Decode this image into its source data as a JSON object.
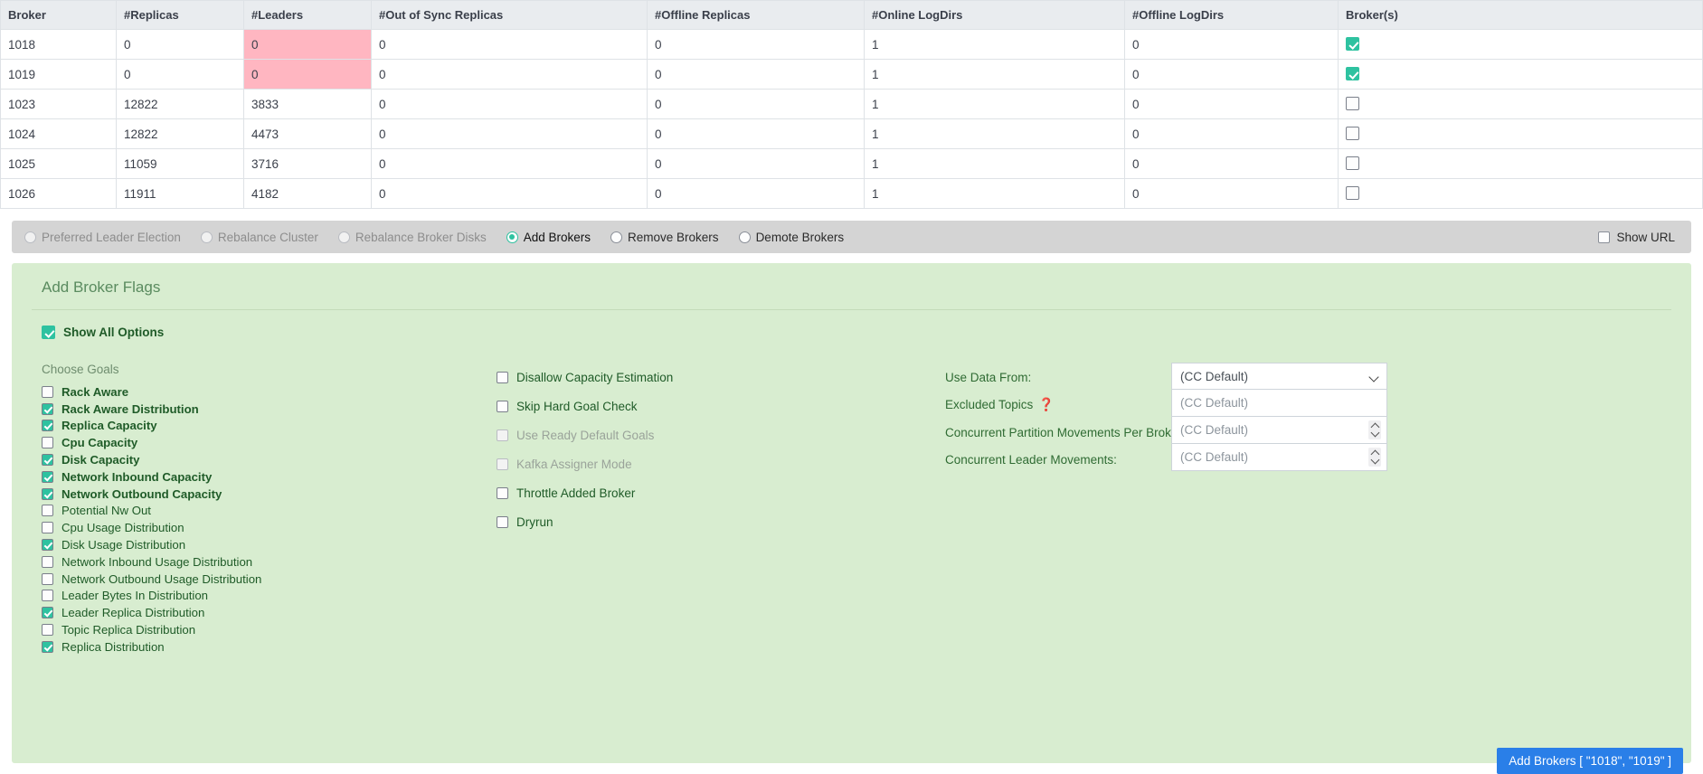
{
  "table": {
    "columns": [
      "Broker",
      "#Replicas",
      "#Leaders",
      "#Out of Sync Replicas",
      "#Offline Replicas",
      "#Online LogDirs",
      "#Offline LogDirs",
      "Broker(s)"
    ],
    "rows": [
      {
        "broker": "1018",
        "replicas": "0",
        "leaders": "0",
        "out_of_sync": "0",
        "offline_replicas": "0",
        "online_logdirs": "1",
        "offline_logdirs": "0",
        "selected": true,
        "leaders_highlighted": true
      },
      {
        "broker": "1019",
        "replicas": "0",
        "leaders": "0",
        "out_of_sync": "0",
        "offline_replicas": "0",
        "online_logdirs": "1",
        "offline_logdirs": "0",
        "selected": true,
        "leaders_highlighted": true
      },
      {
        "broker": "1023",
        "replicas": "12822",
        "leaders": "3833",
        "out_of_sync": "0",
        "offline_replicas": "0",
        "online_logdirs": "1",
        "offline_logdirs": "0",
        "selected": false,
        "leaders_highlighted": false
      },
      {
        "broker": "1024",
        "replicas": "12822",
        "leaders": "4473",
        "out_of_sync": "0",
        "offline_replicas": "0",
        "online_logdirs": "1",
        "offline_logdirs": "0",
        "selected": false,
        "leaders_highlighted": false
      },
      {
        "broker": "1025",
        "replicas": "11059",
        "leaders": "3716",
        "out_of_sync": "0",
        "offline_replicas": "0",
        "online_logdirs": "1",
        "offline_logdirs": "0",
        "selected": false,
        "leaders_highlighted": false
      },
      {
        "broker": "1026",
        "replicas": "11911",
        "leaders": "4182",
        "out_of_sync": "0",
        "offline_replicas": "0",
        "online_logdirs": "1",
        "offline_logdirs": "0",
        "selected": false,
        "leaders_highlighted": false
      }
    ]
  },
  "action_bar": {
    "options": [
      {
        "label": "Preferred Leader Election",
        "selected": false,
        "disabled": true
      },
      {
        "label": "Rebalance Cluster",
        "selected": false,
        "disabled": true
      },
      {
        "label": "Rebalance Broker Disks",
        "selected": false,
        "disabled": true
      },
      {
        "label": "Add Brokers",
        "selected": true,
        "disabled": false
      },
      {
        "label": "Remove Brokers",
        "selected": false,
        "disabled": false
      },
      {
        "label": "Demote Brokers",
        "selected": false,
        "disabled": false
      }
    ],
    "show_url": {
      "label": "Show URL",
      "checked": false
    }
  },
  "flags_panel": {
    "title": "Add Broker Flags",
    "show_all_options": {
      "label": "Show All Options",
      "checked": true
    },
    "choose_goals_label": "Choose Goals",
    "goals": [
      {
        "label": "Rack Aware",
        "checked": false,
        "bold": true
      },
      {
        "label": "Rack Aware Distribution",
        "checked": true,
        "bold": true
      },
      {
        "label": "Replica Capacity",
        "checked": true,
        "bold": true
      },
      {
        "label": "Cpu Capacity",
        "checked": false,
        "bold": true
      },
      {
        "label": "Disk Capacity",
        "checked": true,
        "bold": true
      },
      {
        "label": "Network Inbound Capacity",
        "checked": true,
        "bold": true
      },
      {
        "label": "Network Outbound Capacity",
        "checked": true,
        "bold": true
      },
      {
        "label": "Potential Nw Out",
        "checked": false,
        "bold": false
      },
      {
        "label": "Cpu Usage Distribution",
        "checked": false,
        "bold": false
      },
      {
        "label": "Disk Usage Distribution",
        "checked": true,
        "bold": false
      },
      {
        "label": "Network Inbound Usage Distribution",
        "checked": false,
        "bold": false
      },
      {
        "label": "Network Outbound Usage Distribution",
        "checked": false,
        "bold": false
      },
      {
        "label": "Leader Bytes In Distribution",
        "checked": false,
        "bold": false
      },
      {
        "label": "Leader Replica Distribution",
        "checked": true,
        "bold": false
      },
      {
        "label": "Topic Replica Distribution",
        "checked": false,
        "bold": false
      },
      {
        "label": "Replica Distribution",
        "checked": true,
        "bold": false
      }
    ],
    "options": [
      {
        "label": "Disallow Capacity Estimation",
        "checked": false,
        "disabled": false
      },
      {
        "label": "Skip Hard Goal Check",
        "checked": false,
        "disabled": false
      },
      {
        "label": "Use Ready Default Goals",
        "checked": false,
        "disabled": true
      },
      {
        "label": "Kafka Assigner Mode",
        "checked": false,
        "disabled": true
      },
      {
        "label": "Throttle Added Broker",
        "checked": false,
        "disabled": false
      },
      {
        "label": "Dryrun",
        "checked": false,
        "disabled": false
      }
    ],
    "fields": [
      {
        "label": "Use Data From:",
        "value": "(CC Default)",
        "control": "select",
        "help": false
      },
      {
        "label": "Excluded Topics",
        "placeholder": "(CC Default)",
        "control": "text",
        "help": true,
        "help_glyph": "❓"
      },
      {
        "label": "Concurrent Partition Movements Per Broker:",
        "placeholder": "(CC Default)",
        "control": "number",
        "help": false
      },
      {
        "label": "Concurrent Leader Movements:",
        "placeholder": "(CC Default)",
        "control": "number",
        "help": false
      }
    ],
    "submit_label": "Add Brokers [ \"1018\", \"1019\" ]"
  },
  "colors": {
    "accent_teal": "#2ec2a0",
    "panel_green": "#d8edd0",
    "highlight_pink": "#ffb6c1",
    "submit_blue": "#2a7fe8",
    "help_red": "#d0103a"
  }
}
